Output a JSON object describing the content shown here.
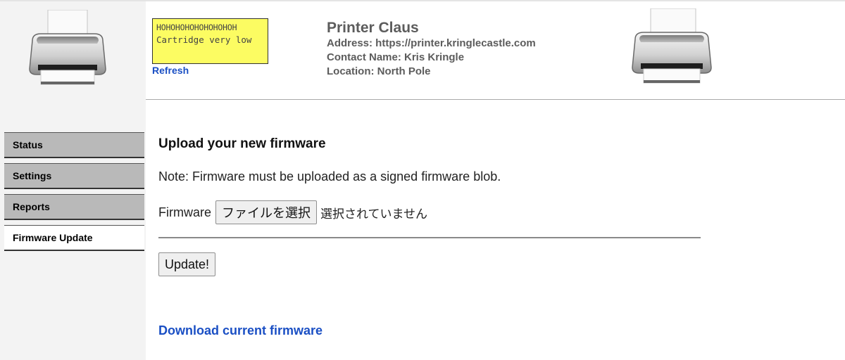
{
  "header": {
    "lcd_line1": "HOHOHOHOHOHOHOHOH",
    "lcd_line2": "Cartridge very low",
    "refresh_label": "Refresh",
    "title": "Printer Claus",
    "address": "Address: https://printer.kringlecastle.com",
    "contact": "Contact Name: Kris Kringle",
    "location": "Location: North Pole",
    "lcd_color": "#fcfc62"
  },
  "nav": {
    "items": [
      {
        "label": "Status"
      },
      {
        "label": "Settings"
      },
      {
        "label": "Reports"
      },
      {
        "label": "Firmware Update"
      }
    ],
    "active": "Firmware Update"
  },
  "main": {
    "title": "Upload your new firmware",
    "note": "Note: Firmware must be uploaded as a signed firmware blob.",
    "firmware_label": "Firmware",
    "file_button_label": "ファイルを選択",
    "file_status": "選択されていません",
    "update_label": "Update!",
    "download_label": "Download current firmware",
    "link_color": "#1a4fc4"
  },
  "icons": {
    "left": "printer-icon",
    "right": "printer-icon"
  }
}
